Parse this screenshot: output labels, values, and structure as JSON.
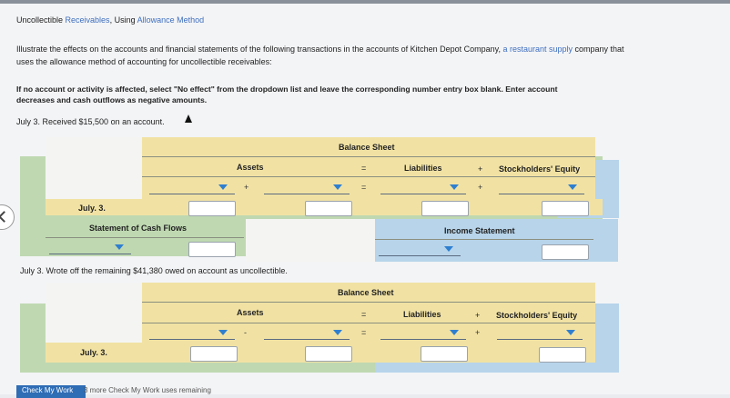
{
  "title": {
    "prefix": "Uncollectible ",
    "link1": "Receivables",
    "mid": ", Using ",
    "link2": "Allowance Method"
  },
  "intro": {
    "line1_a": "Illustrate the effects on the accounts and financial statements of the following transactions in the accounts of Kitchen Depot Company, ",
    "line1_link": "a restaurant supply",
    "line1_b": " company that",
    "line2": "uses the allowance method of accounting for uncollectible receivables:"
  },
  "instructions": {
    "line1": "If no account or activity is affected, select \"No effect\" from the dropdown list and leave the corresponding number entry box blank. Enter account",
    "line2": "decreases and cash outflows as negative amounts."
  },
  "transactions": [
    {
      "text": "July 3. Received $15,500 on an account.",
      "balance_sheet": "Balance Sheet",
      "assets": "Assets",
      "liabilities": "Liabilities",
      "equity": "Stockholders' Equity",
      "eq": "=",
      "plus": "+",
      "row_label": "July. 3.",
      "cash_flows": "Statement of Cash Flows",
      "income": "Income Statement"
    },
    {
      "text": "July 3. Wrote off the remaining $41,380 owed on account as uncollectible.",
      "balance_sheet": "Balance Sheet",
      "assets": "Assets",
      "liabilities": "Liabilities",
      "equity": "Stockholders' Equity",
      "eq": "=",
      "plus": "+",
      "minus": "-",
      "row_label": "July. 3."
    }
  ],
  "footer": {
    "check_button": "Check My Work",
    "remaining": "3 more Check My Work uses remaining"
  }
}
